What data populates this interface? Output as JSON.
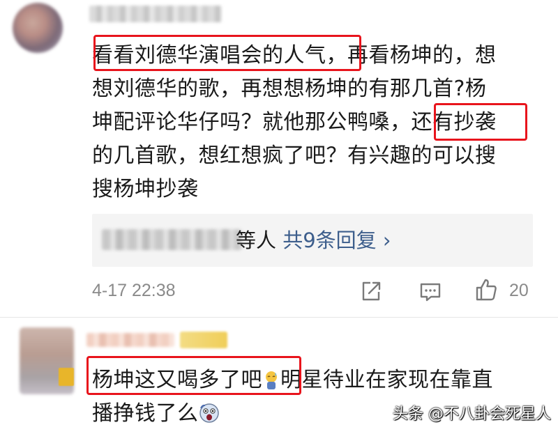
{
  "comments": [
    {
      "lines": [
        "看看刘德华演唱会的人气，再看杨坤的，想",
        "想刘德华的歌，再想想杨坤的有那几首?杨",
        "坤配评论华仔吗？就他那公鸭嗓，还有抄袭",
        "的几首歌，想红想疯了吧？有兴趣的可以搜",
        "搜杨坤抄袭"
      ],
      "reply_summary": {
        "suffix": "等人",
        "more": "共9条回复 ›"
      },
      "timestamp": "4-17 22:38",
      "like_count": "20"
    },
    {
      "line1_highlight": "杨坤这又喝多了吧",
      "line1_rest": "明星待业在家现在靠直",
      "line2": "播挣钱了么"
    }
  ],
  "watermark": "头条 @不八卦会死星人",
  "colors": {
    "highlight_border": "#e8141c",
    "link": "#3d5e8c",
    "meta_text": "#8a8a8a"
  },
  "icons": [
    "share-icon",
    "comment-icon",
    "like-icon",
    "sweat-emoji-icon",
    "shocked-emoji-icon"
  ]
}
